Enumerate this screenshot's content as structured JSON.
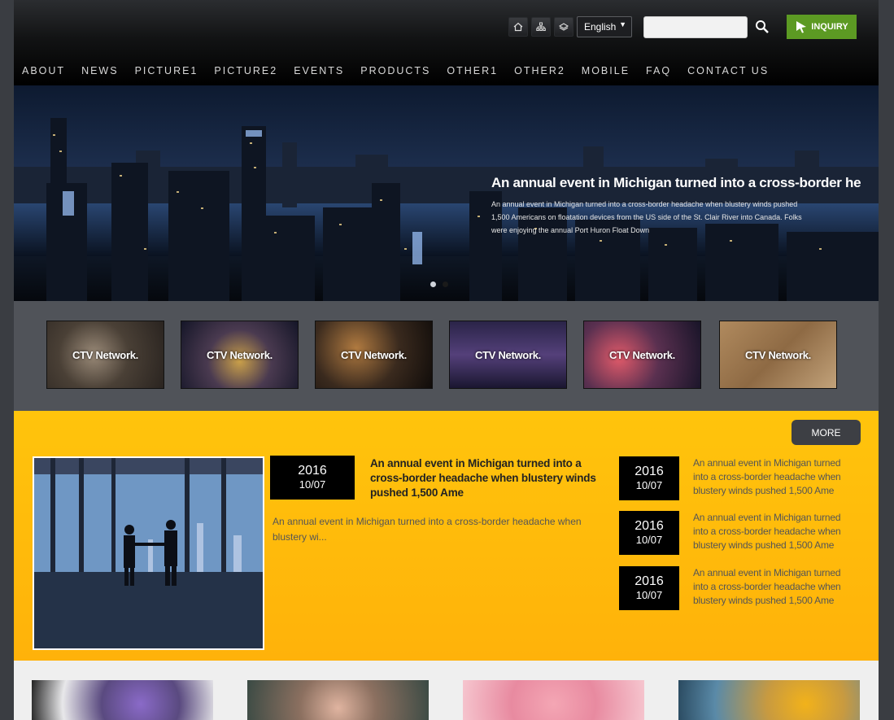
{
  "header": {
    "language": {
      "selected": "English",
      "caret": "▼"
    },
    "search": {
      "placeholder": ""
    },
    "inquiry_label": "INQUIRY"
  },
  "nav": {
    "items": [
      "ABOUT",
      "NEWS",
      "PICTURE1",
      "PICTURE2",
      "EVENTS",
      "PRODUCTS",
      "OTHER1",
      "OTHER2",
      "MOBILE",
      "FAQ",
      "CONTACT US"
    ]
  },
  "banner": {
    "title": "An annual event in Michigan turned into a cross-border he",
    "text": "An annual event in Michigan turned into a cross-border headache when blustery winds pushed 1,500 Americans on floatation devices from the US side of the St. Clair River into Canada. Folks were enjoying the annual Port Huron Float Down",
    "slide_count": 2,
    "active_slide": 2
  },
  "thumbnails": {
    "label": "CTV Network."
  },
  "news": {
    "more_label": "MORE",
    "featured": {
      "year": "2016",
      "date": "10/07",
      "title": "An annual event in Michigan turned into a cross-border headache when blustery winds pushed 1,500 Ame",
      "excerpt": "An annual event in Michigan turned into a cross-border headache when blustery wi..."
    },
    "side": [
      {
        "year": "2016",
        "date": "10/07",
        "text": "An annual event in Michigan turned into a cross-border headache when blustery winds pushed 1,500 Ame"
      },
      {
        "year": "2016",
        "date": "10/07",
        "text": "An annual event in Michigan turned into a cross-border headache when blustery winds pushed 1,500 Ame"
      },
      {
        "year": "2016",
        "date": "10/07",
        "text": "An annual event in Michigan turned into a cross-border headache when blustery winds pushed 1,500 Ame"
      }
    ]
  },
  "colors": {
    "accent_green": "#5c9a23",
    "news_yellow": "#ffc40c",
    "header_black": "#000000"
  }
}
